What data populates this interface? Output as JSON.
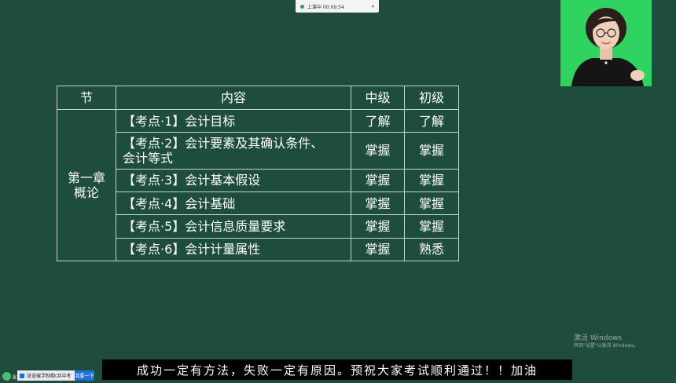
{
  "recording": {
    "label": "上课中 00:09:54",
    "status_color": "#2a9d5c"
  },
  "table": {
    "headers": {
      "section": "节",
      "content": "内容",
      "intermediate": "中级",
      "junior": "初级"
    },
    "chapter": [
      "第一章",
      "概论"
    ],
    "rows": [
      {
        "topic": "【考点·1】会计目标",
        "intermediate": "了解",
        "junior": "了解"
      },
      {
        "topic_lines": [
          "【考点·2】会计要素及其确认条件、",
          "会计等式"
        ],
        "intermediate": "掌握",
        "junior": "掌握"
      },
      {
        "topic": "【考点·3】会计基本假设",
        "intermediate": "掌握",
        "junior": "掌握"
      },
      {
        "topic": "【考点·4】会计基础",
        "intermediate": "掌握",
        "junior": "掌握"
      },
      {
        "topic": "【考点·5】会计信息质量要求",
        "intermediate": "掌握",
        "junior": "掌握"
      },
      {
        "topic": "【考点·6】会计计量属性",
        "intermediate": "掌握",
        "junior": "熟悉"
      }
    ]
  },
  "watermark": {
    "title": "激活 Windows",
    "subtitle": "转到\"设置\"以激活 Windows。"
  },
  "subtitle": "成功一定有方法，失败一定有原因。预祝大家考试顺利通过！！加油",
  "taskbar": {
    "left_label": "课",
    "chip_label": "张谊璀学制期(共中考",
    "button_label": "我要一下"
  },
  "colors": {
    "background": "#1e4d3d",
    "webcam_background": "#2fd35f",
    "table_border": "#c9d4cf"
  }
}
